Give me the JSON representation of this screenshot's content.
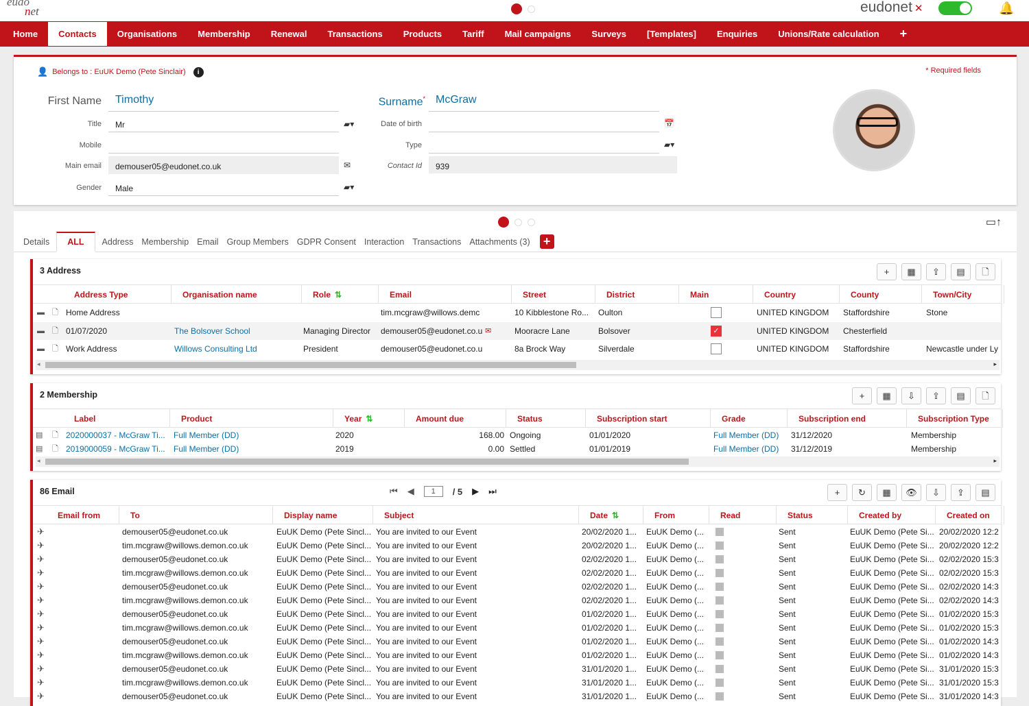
{
  "topbar": {
    "logo_line1": "eudo",
    "logo_line2": "net",
    "brand": "eudonet",
    "brand_mark": "✕"
  },
  "nav": {
    "items": [
      "Home",
      "Contacts",
      "Organisations",
      "Membership",
      "Renewal",
      "Transactions",
      "Products",
      "Tariff",
      "Mail campaigns",
      "Surveys",
      "[Templates]",
      "Enquiries",
      "Unions/Rate calculation",
      "+"
    ],
    "active": "Contacts"
  },
  "contact": {
    "belongs_to": "Belongs to : EuUK Demo (Pete Sinclair)",
    "required": "* Required fields",
    "first_name_label": "First Name",
    "first_name": "Timothy",
    "surname_label": "Surname",
    "surname": "McGraw",
    "title_label": "Title",
    "title": "Mr",
    "mobile_label": "Mobile",
    "mobile": "",
    "email_label": "Main email",
    "email": "demouser05@eudonet.co.uk",
    "gender_label": "Gender",
    "gender": "Male",
    "dob_label": "Date of birth",
    "dob": "",
    "type_label": "Type",
    "type": "",
    "contact_id_label": "Contact Id",
    "contact_id": "939"
  },
  "tabs": [
    "Details",
    "ALL",
    "Address",
    "Membership",
    "Email",
    "Group Members",
    "GDPR Consent",
    "Interaction",
    "Transactions",
    "Attachments (3)"
  ],
  "address": {
    "title": "3 Address",
    "headers": [
      "Address Type",
      "Organisation name",
      "Role",
      "Email",
      "Street",
      "District",
      "Main",
      "Country",
      "County",
      "Town/City"
    ],
    "rows": [
      {
        "type": "Home Address",
        "org": "",
        "role": "",
        "email": "tim.mcgraw@willows.demc",
        "street": "10 Kibblestone Ro...",
        "district": "Oulton",
        "main": false,
        "country": "UNITED KINGDOM",
        "county": "Staffordshire",
        "town": "Stone"
      },
      {
        "type": "01/07/2020",
        "org": "The Bolsover School",
        "role": "Managing Director",
        "email": "demouser05@eudonet.co.u",
        "street": "Mooracre Lane",
        "district": "Bolsover",
        "main": true,
        "country": "UNITED KINGDOM",
        "county": "Chesterfield",
        "town": ""
      },
      {
        "type": "Work Address",
        "org": "Willows Consulting Ltd",
        "role": "President",
        "email": "demouser05@eudonet.co.u",
        "street": "8a Brock Way",
        "district": "Silverdale",
        "main": false,
        "country": "UNITED KINGDOM",
        "county": "Staffordshire",
        "town": "Newcastle under Ly"
      }
    ]
  },
  "membership": {
    "title": "2 Membership",
    "headers": [
      "Label",
      "Product",
      "Year",
      "Amount due",
      "Status",
      "Subscription start",
      "Grade",
      "Subscription end",
      "Subscription Type"
    ],
    "rows": [
      {
        "label": "2020000037 - McGraw Ti...",
        "product": "Full Member (DD)",
        "year": "2020",
        "amount": "168.00",
        "status": "Ongoing",
        "start": "01/01/2020",
        "grade": "Full Member (DD)",
        "end": "31/12/2020",
        "stype": "Membership"
      },
      {
        "label": "2019000059 - McGraw Ti...",
        "product": "Full Member (DD)",
        "year": "2019",
        "amount": "0.00",
        "status": "Settled",
        "start": "01/01/2019",
        "grade": "Full Member (DD)",
        "end": "31/12/2019",
        "stype": "Membership"
      }
    ]
  },
  "email": {
    "title": "86 Email",
    "page": "1",
    "pages": "/ 5",
    "headers": [
      "Email from",
      "To",
      "Display name",
      "Subject",
      "Date",
      "From",
      "Read",
      "Status",
      "Created by",
      "Created on"
    ],
    "rows": [
      {
        "to": "demouser05@eudonet.co.uk",
        "display": "EuUK Demo (Pete Sincl...",
        "subject": "You are invited to our Event",
        "date": "20/02/2020 1...",
        "from": "EuUK Demo (...",
        "status": "Sent",
        "by": "EuUK Demo (Pete Si...",
        "on": "20/02/2020 12:2"
      },
      {
        "to": "tim.mcgraw@willows.demon.co.uk",
        "display": "EuUK Demo (Pete Sincl...",
        "subject": "You are invited to our Event",
        "date": "20/02/2020 1...",
        "from": "EuUK Demo (...",
        "status": "Sent",
        "by": "EuUK Demo (Pete Si...",
        "on": "20/02/2020 12:2"
      },
      {
        "to": "demouser05@eudonet.co.uk",
        "display": "EuUK Demo (Pete Sincl...",
        "subject": "You are invited to our Event",
        "date": "02/02/2020 1...",
        "from": "EuUK Demo (...",
        "status": "Sent",
        "by": "EuUK Demo (Pete Si...",
        "on": "02/02/2020 15:3"
      },
      {
        "to": "tim.mcgraw@willows.demon.co.uk",
        "display": "EuUK Demo (Pete Sincl...",
        "subject": "You are invited to our Event",
        "date": "02/02/2020 1...",
        "from": "EuUK Demo (...",
        "status": "Sent",
        "by": "EuUK Demo (Pete Si...",
        "on": "02/02/2020 15:3"
      },
      {
        "to": "demouser05@eudonet.co.uk",
        "display": "EuUK Demo (Pete Sincl...",
        "subject": "You are invited to our Event",
        "date": "02/02/2020 1...",
        "from": "EuUK Demo (...",
        "status": "Sent",
        "by": "EuUK Demo (Pete Si...",
        "on": "02/02/2020 14:3"
      },
      {
        "to": "tim.mcgraw@willows.demon.co.uk",
        "display": "EuUK Demo (Pete Sincl...",
        "subject": "You are invited to our Event",
        "date": "02/02/2020 1...",
        "from": "EuUK Demo (...",
        "status": "Sent",
        "by": "EuUK Demo (Pete Si...",
        "on": "02/02/2020 14:3"
      },
      {
        "to": "demouser05@eudonet.co.uk",
        "display": "EuUK Demo (Pete Sincl...",
        "subject": "You are invited to our Event",
        "date": "01/02/2020 1...",
        "from": "EuUK Demo (...",
        "status": "Sent",
        "by": "EuUK Demo (Pete Si...",
        "on": "01/02/2020 15:3"
      },
      {
        "to": "tim.mcgraw@willows.demon.co.uk",
        "display": "EuUK Demo (Pete Sincl...",
        "subject": "You are invited to our Event",
        "date": "01/02/2020 1...",
        "from": "EuUK Demo (...",
        "status": "Sent",
        "by": "EuUK Demo (Pete Si...",
        "on": "01/02/2020 15:3"
      },
      {
        "to": "demouser05@eudonet.co.uk",
        "display": "EuUK Demo (Pete Sincl...",
        "subject": "You are invited to our Event",
        "date": "01/02/2020 1...",
        "from": "EuUK Demo (...",
        "status": "Sent",
        "by": "EuUK Demo (Pete Si...",
        "on": "01/02/2020 14:3"
      },
      {
        "to": "tim.mcgraw@willows.demon.co.uk",
        "display": "EuUK Demo (Pete Sincl...",
        "subject": "You are invited to our Event",
        "date": "01/02/2020 1...",
        "from": "EuUK Demo (...",
        "status": "Sent",
        "by": "EuUK Demo (Pete Si...",
        "on": "01/02/2020 14:3"
      },
      {
        "to": "demouser05@eudonet.co.uk",
        "display": "EuUK Demo (Pete Sincl...",
        "subject": "You are invited to our Event",
        "date": "31/01/2020 1...",
        "from": "EuUK Demo (...",
        "status": "Sent",
        "by": "EuUK Demo (Pete Si...",
        "on": "31/01/2020 15:3"
      },
      {
        "to": "tim.mcgraw@willows.demon.co.uk",
        "display": "EuUK Demo (Pete Sincl...",
        "subject": "You are invited to our Event",
        "date": "31/01/2020 1...",
        "from": "EuUK Demo (...",
        "status": "Sent",
        "by": "EuUK Demo (Pete Si...",
        "on": "31/01/2020 15:3"
      },
      {
        "to": "demouser05@eudonet.co.uk",
        "display": "EuUK Demo (Pete Sincl...",
        "subject": "You are invited to our Event",
        "date": "31/01/2020 1...",
        "from": "EuUK Demo (...",
        "status": "Sent",
        "by": "EuUK Demo (Pete Si...",
        "on": "31/01/2020 14:3"
      }
    ]
  },
  "colors": {
    "accent": "#c0141a",
    "link": "#0b6fa4",
    "toggle": "#2eb82e"
  }
}
